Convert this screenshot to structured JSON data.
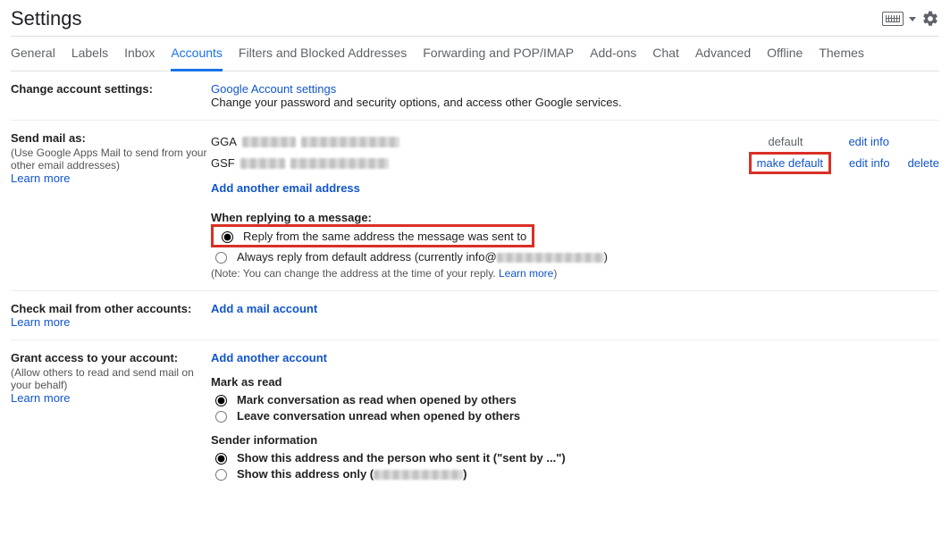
{
  "header": {
    "title": "Settings"
  },
  "tabs": [
    "General",
    "Labels",
    "Inbox",
    "Accounts",
    "Filters and Blocked Addresses",
    "Forwarding and POP/IMAP",
    "Add-ons",
    "Chat",
    "Advanced",
    "Offline",
    "Themes"
  ],
  "active_tab": "Accounts",
  "sections": {
    "change_account": {
      "heading": "Change account settings:",
      "link": "Google Account settings",
      "desc": "Change your password and security options, and access other Google services."
    },
    "send_mail": {
      "heading": "Send mail as:",
      "sub": "(Use Google Apps Mail to send from your other email addresses)",
      "learn_more": "Learn more",
      "accounts": [
        {
          "name": "GGA",
          "status": "default",
          "edit": "edit info",
          "make_default": "",
          "delete": ""
        },
        {
          "name": "GSF",
          "status": "",
          "edit": "edit info",
          "make_default": "make default",
          "delete": "delete"
        }
      ],
      "add_link": "Add another email address",
      "reply_heading": "When replying to a message:",
      "reply_opt1": "Reply from the same address the message was sent to",
      "reply_opt2_prefix": "Always reply from default address (currently info@",
      "reply_opt2_suffix": ")",
      "note_prefix": "(Note: You can change the address at the time of your reply. ",
      "note_link": "Learn more",
      "note_suffix": ")"
    },
    "check_mail": {
      "heading": "Check mail from other accounts:",
      "learn_more": "Learn more",
      "add_link": "Add a mail account"
    },
    "grant_access": {
      "heading": "Grant access to your account:",
      "sub": "(Allow others to read and send mail on your behalf)",
      "learn_more": "Learn more",
      "add_link": "Add another account",
      "mark_heading": "Mark as read",
      "mark_opt1": "Mark conversation as read when opened by others",
      "mark_opt2": "Leave conversation unread when opened by others",
      "sender_heading": "Sender information",
      "sender_opt1": "Show this address and the person who sent it (\"sent by ...\")",
      "sender_opt2_prefix": "Show this address only (",
      "sender_opt2_suffix": ")"
    }
  }
}
